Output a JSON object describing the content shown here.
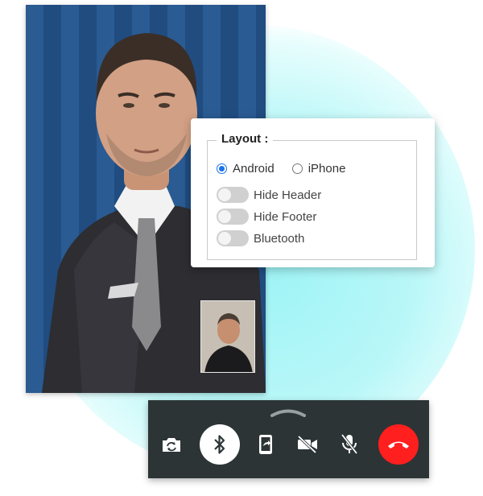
{
  "layout_panel": {
    "title": "Layout :",
    "platform_options": [
      {
        "label": "Android",
        "selected": true
      },
      {
        "label": "iPhone",
        "selected": false
      }
    ],
    "toggles": [
      {
        "label": "Hide Header",
        "on": false
      },
      {
        "label": "Hide Footer",
        "on": false
      },
      {
        "label": "Bluetooth",
        "on": false
      }
    ]
  },
  "call_controls": [
    {
      "icon": "camera-switch-icon"
    },
    {
      "icon": "bluetooth-icon",
      "active": true
    },
    {
      "icon": "screen-share-icon"
    },
    {
      "icon": "video-off-icon"
    },
    {
      "icon": "mic-off-icon"
    },
    {
      "icon": "end-call-icon",
      "color": "#ff1f1f"
    }
  ],
  "colors": {
    "accent": "#1a73e8",
    "end_call": "#ff1f1f",
    "bar_background": "#2c3436",
    "glow": "#9ff4f6"
  }
}
